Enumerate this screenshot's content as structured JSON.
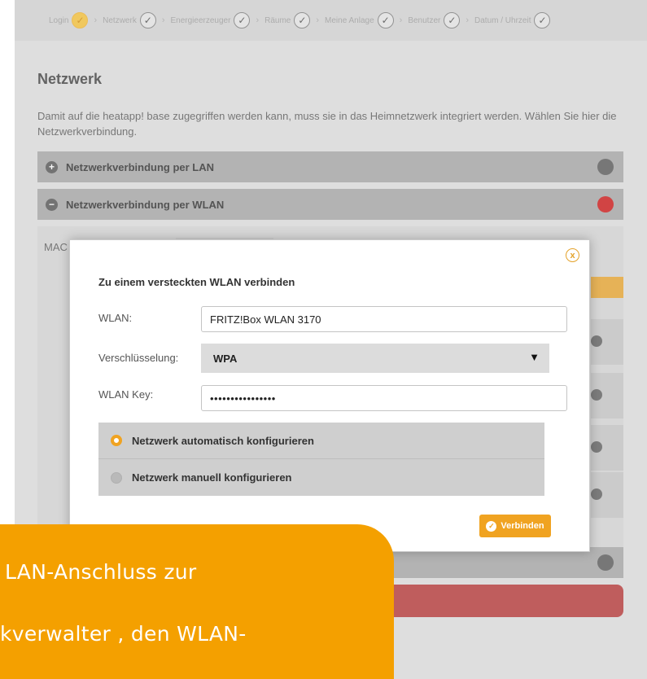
{
  "wizard": {
    "steps": [
      {
        "label": "Login",
        "state": "active"
      },
      {
        "label": "Netzwerk",
        "state": "done"
      },
      {
        "label": "Energieerzeuger",
        "state": "done"
      },
      {
        "label": "Räume",
        "state": "done"
      },
      {
        "label": "Meine Anlage",
        "state": "done"
      },
      {
        "label": "Benutzer",
        "state": "done"
      },
      {
        "label": "Datum / Uhrzeit",
        "state": "done"
      }
    ],
    "check_glyph": "✓",
    "separator_glyph": "›"
  },
  "page": {
    "title": "Netzwerk",
    "intro": "Damit auf die heatapp! base zugegriffen werden kann, muss sie in das Heimnetzwerk integriert werden. Wählen Sie hier die Netzwerkverbindung."
  },
  "accordion": {
    "lan": {
      "label": "Netzwerkverbindung per LAN",
      "toggle": "+",
      "status_color": "#555555"
    },
    "wlan": {
      "label": "Netzwerkverbindung per WLAN",
      "toggle": "−",
      "status_color": "#cc1111"
    },
    "mac_label": "MAC"
  },
  "dialog": {
    "title": "Zu einem versteckten WLAN verbinden",
    "close_icon": "x",
    "wlan": {
      "label": "WLAN:",
      "value": "FRITZ!Box WLAN 3170"
    },
    "encryption": {
      "label": "Verschlüsselung:",
      "value": "WPA",
      "arrow": "▼"
    },
    "key": {
      "label": "WLAN Key:",
      "value": "••••••••••••••••"
    },
    "options": [
      {
        "label": "Netzwerk automatisch konfigurieren",
        "selected": true
      },
      {
        "label": "Netzwerk manuell konfigurieren",
        "selected": false
      }
    ],
    "connect_button": "Verbinden"
  },
  "caption": {
    "line1": "LAN-Anschluss zur",
    "line2": "kverwalter , den WLAN-"
  },
  "colors": {
    "accent": "#f0a321",
    "caption_bg": "#f4a000"
  }
}
